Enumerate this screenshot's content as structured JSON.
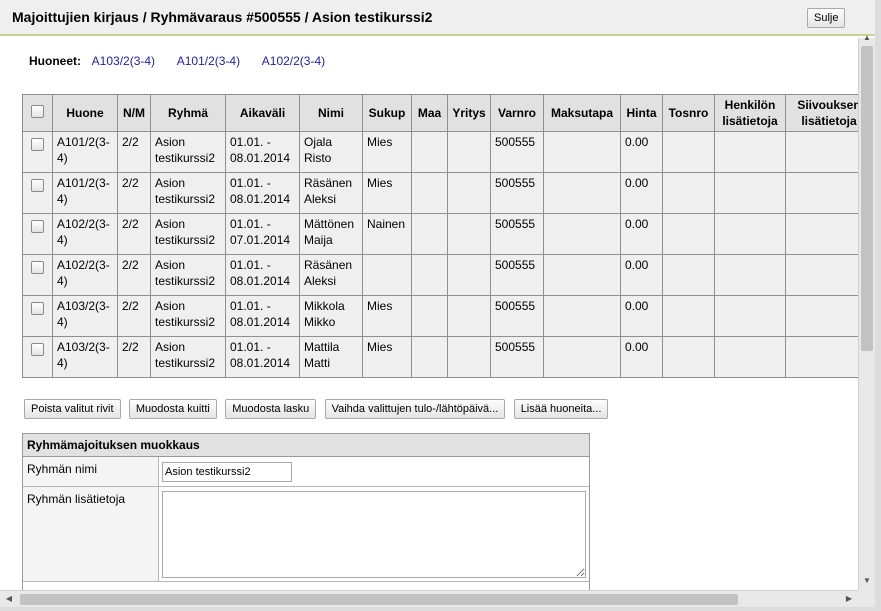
{
  "header": {
    "title": "Majoittujien kirjaus / Ryhmävaraus #500555 / Asion testikurssi2",
    "close_label": "Sulje"
  },
  "rooms": {
    "label": "Huoneet:",
    "links": [
      "A103/2(3-4)",
      "A101/2(3-4)",
      "A102/2(3-4)"
    ]
  },
  "table": {
    "columns": [
      "Huone",
      "N/M",
      "Ryhmä",
      "Aikaväli",
      "Nimi",
      "Sukup",
      "Maa",
      "Yritys",
      "Varnro",
      "Maksutapa",
      "Hinta",
      "Tosnro",
      "Henkilön lisätietoja",
      "Siivouksen lisätietoja"
    ],
    "rows": [
      {
        "huone": "A101/2(3-4)",
        "nm": "2/2",
        "ryhma": "Asion testikurssi2",
        "aikavali": "01.01. - 08.01.2014",
        "nimi": "Ojala Risto",
        "sukup": "Mies",
        "maa": "",
        "yritys": "",
        "varnro": "500555",
        "maksutapa": "",
        "hinta": "0.00",
        "tosnro": "",
        "hlisa": "",
        "slisa": ""
      },
      {
        "huone": "A101/2(3-4)",
        "nm": "2/2",
        "ryhma": "Asion testikurssi2",
        "aikavali": "01.01. - 08.01.2014",
        "nimi": "Räsänen Aleksi",
        "sukup": "Mies",
        "maa": "",
        "yritys": "",
        "varnro": "500555",
        "maksutapa": "",
        "hinta": "0.00",
        "tosnro": "",
        "hlisa": "",
        "slisa": ""
      },
      {
        "huone": "A102/2(3-4)",
        "nm": "2/2",
        "ryhma": "Asion testikurssi2",
        "aikavali": "01.01. - 07.01.2014",
        "nimi": "Mättönen Maija",
        "sukup": "Nainen",
        "maa": "",
        "yritys": "",
        "varnro": "500555",
        "maksutapa": "",
        "hinta": "0.00",
        "tosnro": "",
        "hlisa": "",
        "slisa": ""
      },
      {
        "huone": "A102/2(3-4)",
        "nm": "2/2",
        "ryhma": "Asion testikurssi2",
        "aikavali": "01.01. - 08.01.2014",
        "nimi": "Räsänen Aleksi",
        "sukup": "",
        "maa": "",
        "yritys": "",
        "varnro": "500555",
        "maksutapa": "",
        "hinta": "0.00",
        "tosnro": "",
        "hlisa": "",
        "slisa": ""
      },
      {
        "huone": "A103/2(3-4)",
        "nm": "2/2",
        "ryhma": "Asion testikurssi2",
        "aikavali": "01.01. - 08.01.2014",
        "nimi": "Mikkola Mikko",
        "sukup": "Mies",
        "maa": "",
        "yritys": "",
        "varnro": "500555",
        "maksutapa": "",
        "hinta": "0.00",
        "tosnro": "",
        "hlisa": "",
        "slisa": ""
      },
      {
        "huone": "A103/2(3-4)",
        "nm": "2/2",
        "ryhma": "Asion testikurssi2",
        "aikavali": "01.01. - 08.01.2014",
        "nimi": "Mattila Matti",
        "sukup": "Mies",
        "maa": "",
        "yritys": "",
        "varnro": "500555",
        "maksutapa": "",
        "hinta": "0.00",
        "tosnro": "",
        "hlisa": "",
        "slisa": ""
      }
    ]
  },
  "actions": [
    "Poista valitut rivit",
    "Muodosta kuitti",
    "Muodosta lasku",
    "Vaihda valittujen tulo-/lähtöpäivä...",
    "Lisää huoneita..."
  ],
  "edit": {
    "title": "Ryhmämajoituksen muokkaus",
    "name_label": "Ryhmän nimi",
    "name_value": "Asion testikurssi2",
    "notes_label": "Ryhmän lisätietoja",
    "notes_value": ""
  },
  "icons": {
    "scroll_up": "arrow-up-icon",
    "scroll_down": "arrow-down-icon",
    "scroll_left": "arrow-left-icon",
    "scroll_right": "arrow-right-icon"
  }
}
